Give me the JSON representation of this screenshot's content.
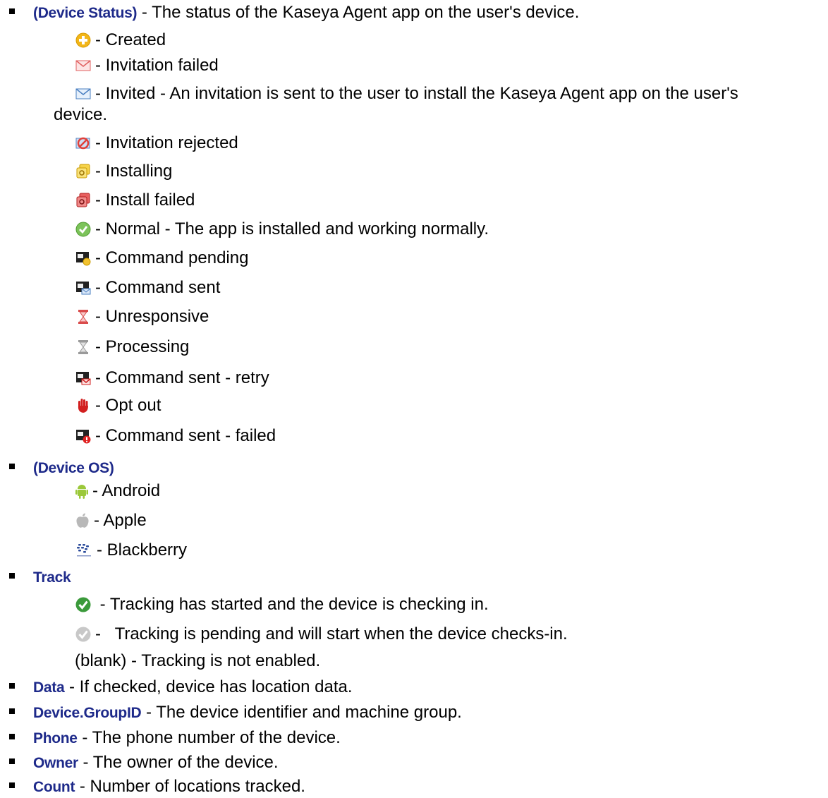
{
  "device_status": {
    "term": "(Device Status)",
    "description": " - The status of the Kaseya Agent app on the user's device.",
    "items": [
      {
        "icon": "plus-circle-icon",
        "label": "- Created"
      },
      {
        "icon": "envelope-red-icon",
        "label": "- Invitation failed"
      },
      {
        "icon": "envelope-blue-icon",
        "label": "- Invited - An invitation is sent to the user to install the Kaseya Agent app on the user's",
        "continuation": "device."
      },
      {
        "icon": "invitation-rejected-icon",
        "label": "- Invitation rejected"
      },
      {
        "icon": "installing-icon",
        "label": "- Installing"
      },
      {
        "icon": "install-failed-icon",
        "label": "- Install failed"
      },
      {
        "icon": "check-circle-green-icon",
        "label": "- Normal - The app is installed and working normally."
      },
      {
        "icon": "command-pending-icon",
        "label": "- Command pending"
      },
      {
        "icon": "command-sent-icon",
        "label": "- Command sent"
      },
      {
        "icon": "hourglass-red-icon",
        "label": "- Unresponsive"
      },
      {
        "icon": "hourglass-gray-icon",
        "label": "- Processing"
      },
      {
        "icon": "command-sent-retry-icon",
        "label": "- Command sent - retry"
      },
      {
        "icon": "hand-stop-icon",
        "label": "- Opt out"
      },
      {
        "icon": "command-sent-failed-icon",
        "label": "- Command sent - failed"
      }
    ]
  },
  "device_os": {
    "term": "(Device OS)",
    "items": [
      {
        "icon": "android-icon",
        "label": "- Android"
      },
      {
        "icon": "apple-icon",
        "label": "- Apple"
      },
      {
        "icon": "blackberry-icon",
        "label": "- Blackberry"
      }
    ]
  },
  "track": {
    "term": "Track",
    "items": [
      {
        "icon": "check-circle-dark-green-icon",
        "label": " - Tracking has started and the device is checking in."
      },
      {
        "icon": "check-circle-gray-icon",
        "label": "-   Tracking is pending and will start when the device checks-in."
      },
      {
        "label": "(blank) - Tracking is not enabled."
      }
    ]
  },
  "fields": [
    {
      "term": "Data",
      "description": " - If checked, device has location data."
    },
    {
      "term": "Device.GroupID",
      "description": " - The device identifier and machine group."
    },
    {
      "term": "Phone",
      "description": " - The phone number of the device."
    },
    {
      "term": "Owner",
      "description": " - The owner of the device."
    },
    {
      "term": "Count",
      "description": " - Number of locations tracked."
    }
  ]
}
